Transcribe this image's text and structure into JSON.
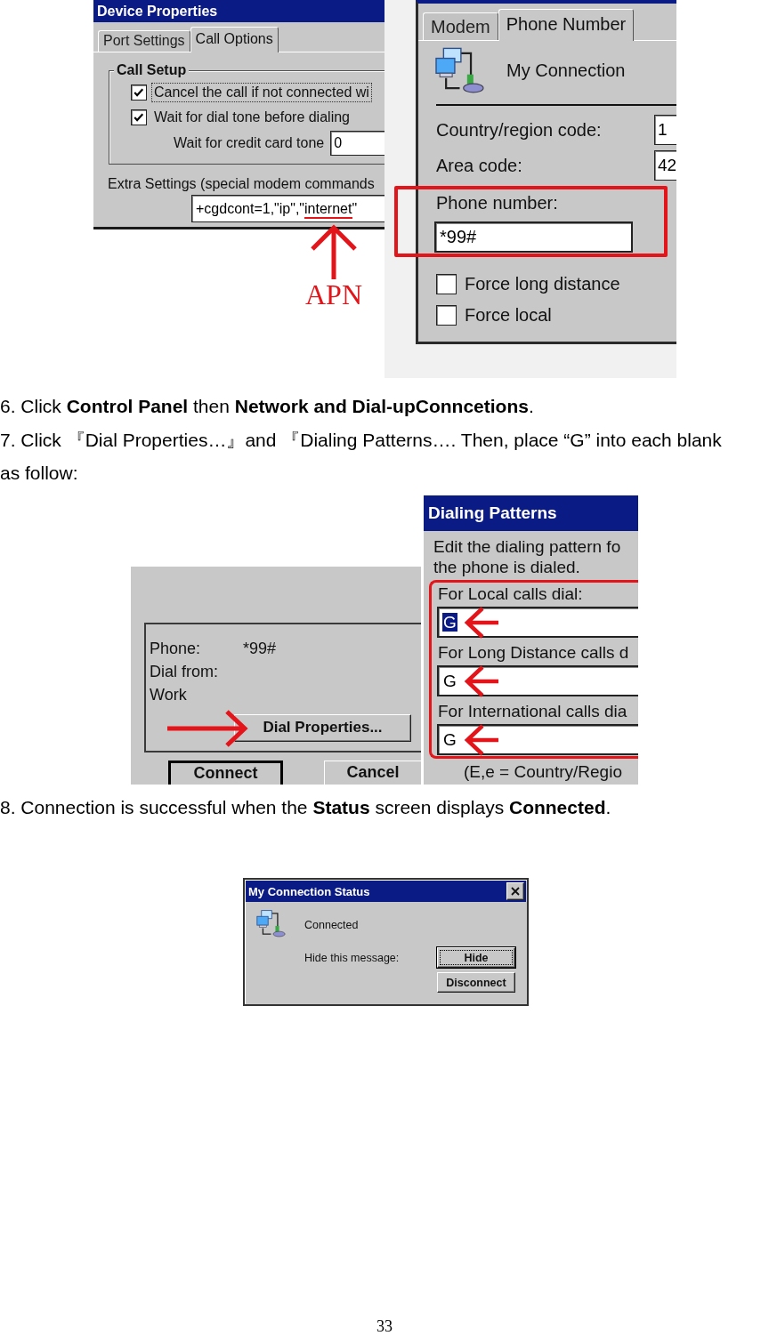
{
  "figure_1": {
    "device_properties": {
      "title": "Device Properties",
      "tabs": [
        {
          "label": "Port Settings",
          "selected": false
        },
        {
          "label": "Call Options",
          "selected": true
        }
      ],
      "call_setup": {
        "title": "Call Setup",
        "options": [
          {
            "label": "Cancel the call if not connected wi",
            "checked": true,
            "focused": true
          },
          {
            "label": "Wait for dial tone before dialing",
            "checked": true,
            "focused": false
          }
        ],
        "credit_card_tone": {
          "label": "Wait for credit card tone",
          "value": "0"
        }
      },
      "extra_settings": {
        "label": "Extra Settings (special modem commands",
        "value": "+cgdcont=1,\"ip\",\"internet\""
      }
    },
    "apn_annotation": {
      "label": "APN"
    },
    "phone_number_dialog": {
      "tabs": [
        {
          "label": "Modem",
          "selected": false
        },
        {
          "label": "Phone Number",
          "selected": true
        }
      ],
      "connection_name": "My Connection",
      "codes": [
        {
          "label": "Country/region code:",
          "value": "1"
        },
        {
          "label": "Area code:",
          "value": "42"
        }
      ],
      "phone_number": {
        "label": "Phone number:",
        "value": "*99#"
      },
      "options": [
        {
          "label": "Force long distance",
          "checked": false
        },
        {
          "label": "Force local",
          "checked": false
        }
      ]
    }
  },
  "instructions": [
    "6. Click **Control Panel** then **Network and Dial-upConncetions**.",
    "7. Click 『Dial Properties…』and 『Dialing Patterns…. Then, place “G” into each blank as follow:"
  ],
  "figure_2": {
    "dial_dialog": {
      "phone": {
        "label": "Phone:",
        "value": "*99#"
      },
      "dial_from": {
        "label": "Dial from:",
        "value": "Work"
      },
      "dial_properties_button": "Dial Properties...",
      "buttons": [
        {
          "label": "Connect",
          "default": true
        },
        {
          "label": "Cancel",
          "default": false
        }
      ]
    },
    "dialing_patterns": {
      "title": "Dialing Patterns",
      "description": [
        "Edit the dialing pattern fo",
        "the phone is dialed."
      ],
      "patterns": [
        {
          "label": "For Local calls dial:",
          "value": "G",
          "selected": true
        },
        {
          "label": "For Long Distance calls d",
          "value": "G",
          "selected": false
        },
        {
          "label": "For International calls dia",
          "value": "G",
          "selected": false
        }
      ],
      "note": "(E,e = Country/Regio"
    }
  },
  "result_instruction": "8. Connection is successful when the **Status** screen displays **Connected**.",
  "status_dialog": {
    "title": "My Connection Status",
    "status": "Connected",
    "hide_prompt": "Hide this message:",
    "buttons": [
      {
        "label": "Hide",
        "default": true
      },
      {
        "label": "Disconnect",
        "default": false
      }
    ]
  },
  "page_number": "33"
}
